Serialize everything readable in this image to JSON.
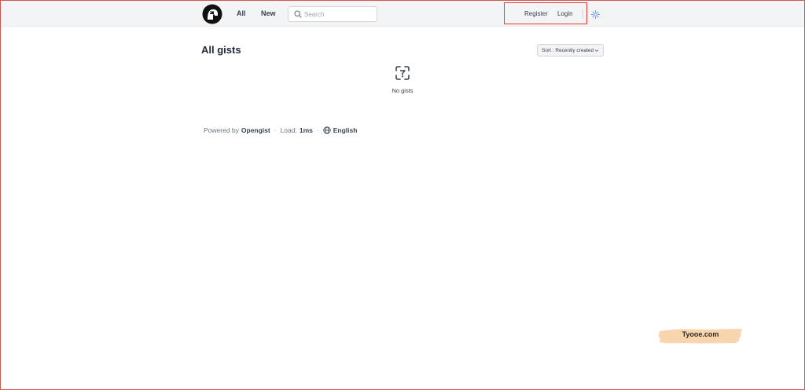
{
  "nav": {
    "all_label": "All",
    "new_label": "New",
    "search_placeholder": "Search",
    "register_label": "Register",
    "login_label": "Login",
    "highlight_color": "#e53935"
  },
  "icons": {
    "logo": "opengist-logo-icon",
    "search": "search-icon",
    "theme": "sun-icon",
    "empty": "gist-empty-icon",
    "globe": "globe-icon",
    "chevron": "chevron-down-icon"
  },
  "main": {
    "title": "All gists",
    "sort_label": "Sort : Recently created",
    "empty_text": "No gists"
  },
  "footer": {
    "powered_by": "Powered by",
    "brand": "Opengist",
    "load_label": "Load:",
    "load_value": "1ms",
    "language": "English",
    "separator": "·"
  },
  "watermark": {
    "text": "Tyooe.com",
    "color": "#f9d5ad"
  }
}
